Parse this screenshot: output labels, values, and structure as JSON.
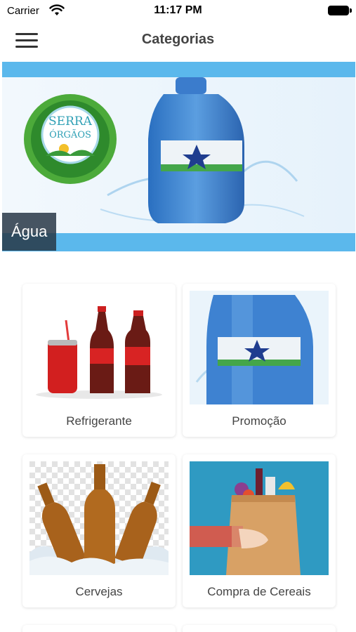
{
  "status_bar": {
    "carrier": "Carrier",
    "time": "11:17 PM"
  },
  "navbar": {
    "title": "Categorias",
    "menu_icon": "hamburger-menu-icon"
  },
  "banner": {
    "label": "Água",
    "logo_text_line1": "SERRA",
    "logo_text_line2": "ÓRGÃOS",
    "accent_color": "#5bb8ec"
  },
  "categories": [
    {
      "label": "Refrigerante",
      "image": "soda-bottles-image"
    },
    {
      "label": "Promoção",
      "image": "water-jug-image"
    },
    {
      "label": "Cervejas",
      "image": "beer-bottles-image"
    },
    {
      "label": "Compra de Cereais",
      "image": "grocery-bag-image"
    }
  ]
}
